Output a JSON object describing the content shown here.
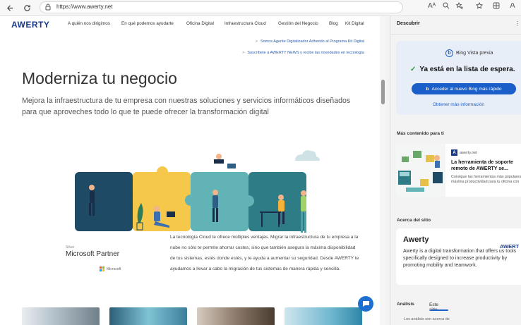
{
  "browser": {
    "url": "https://www.awerty.net",
    "icons": {
      "back": "arrow-left-icon",
      "refresh": "refresh-icon",
      "lock": "lock-icon",
      "read_aloud": "read-aloud-icon",
      "zoom": "zoom-icon",
      "favorite": "favorite-icon",
      "collections": "collections-icon",
      "extensions": "extensions-icon",
      "copilot": "copilot-icon"
    },
    "read_aloud_text": "Aᴬ"
  },
  "site": {
    "logo": "AWERTY",
    "nav": [
      "A quién nos dirigimos",
      "En qué podemos ayudarte",
      "Oficina Digital",
      "Infraestructura Cloud",
      "Gestión del Negocio",
      "Blog",
      "Kit Digital"
    ],
    "news": [
      "Somos Agente Digitalizador Adherido al Programa Kit Digital",
      "Suscríbete a AWERTY NEWS y recibe las novedades en tecnología"
    ],
    "hero_title": "Moderniza tu negocio",
    "hero_subtitle": "Mejora la infraestructura de tu empresa con nuestras soluciones y servicios informáticos diseñados para que aproveches todo lo que te puede ofrecer la transformación digital",
    "partner": {
      "level": "Silver",
      "name": "Microsoft Partner",
      "microsoft": "Microsoft"
    },
    "body_text": "La tecnología Cloud te ofrece múltiples ventajas. Migrar la infraestructura de tu empresa a la nube no sólo te permite ahorrar costes, sino que también asegura la máxima disponibilidad de tus sistemas, estés donde estés, y te ayuda a aumentar su seguridad. Desde AWERTY te ayudamos a llevar a cabo la migración de tus sistemas de manera rápida y sencilla."
  },
  "sidebar": {
    "header": "Descubrir",
    "bing": {
      "label": "Bing Vista previa",
      "waitlist": "Ya está en la lista de espera.",
      "button": "Acceder al nuevo Bing más rápido",
      "more": "Obtener más información"
    },
    "more_for_you": "Más contenido para ti",
    "article": {
      "site": "awerty.net",
      "title": "La herramienta de soporte remoto de AWERTY se...",
      "description": "Consigue las herramientas más populares y la máxima productividad para tu oficina con"
    },
    "about_title": "Acerca del sitio",
    "about": {
      "name": "Awerty",
      "brand": "AWERT",
      "description": "Awerty is a digital transformation that offers us tools specifically designed to increase productivity by promoting mobility and teamwork."
    },
    "tabs": {
      "analysis": "Análisis",
      "this_site": "Este sitio"
    },
    "analysis_text": "Los análisis son acerca de"
  },
  "colors": {
    "brand": "#1a3a8a",
    "bing_blue": "#1a5fc9",
    "puzzle_navy": "#1f4a66",
    "puzzle_yellow": "#f5c74a",
    "puzzle_teal": "#62b3b5",
    "puzzle_dark_teal": "#2e7d86"
  }
}
